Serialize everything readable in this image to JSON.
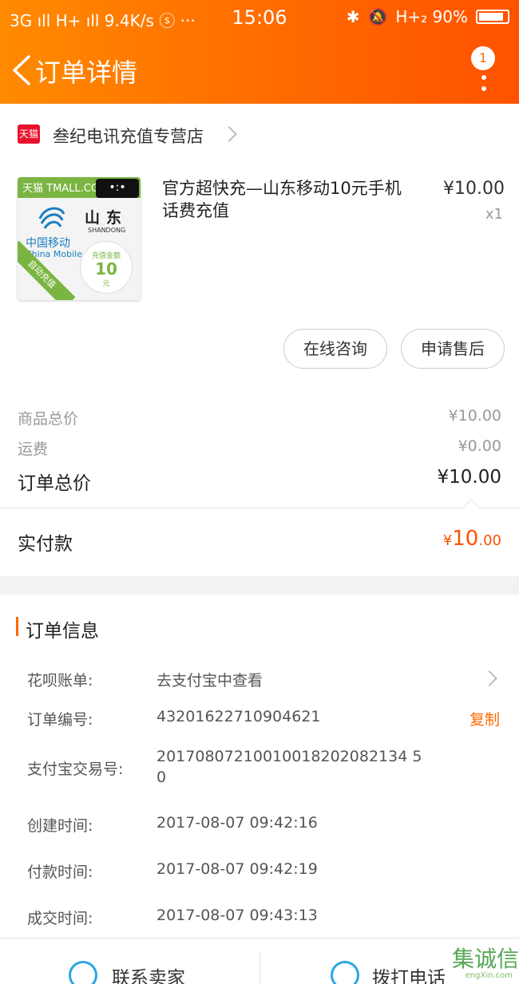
{
  "status_bar": {
    "left": "3G ıll H+ ıll 9.4K/s ⓢ ···",
    "time": "15:06",
    "right": "H+₂ 90%"
  },
  "header": {
    "title": "订单详情",
    "badge_count": "1"
  },
  "shop": {
    "logo_text": "天猫",
    "name": "叁纪电讯充值专营店"
  },
  "product": {
    "image": {
      "brand": "天猫 TMALL.COM",
      "cat_face": "•:•",
      "province": "山东",
      "province_en": "SHANDONG",
      "carrier_cn": "中国移动",
      "carrier_en": "China Mobile",
      "amount_label": "充值金额",
      "amount": "10",
      "unit": "元",
      "ribbon": "自动充值"
    },
    "title": "官方超快充—山东移动10元手机话费充值",
    "price": "¥10.00",
    "quantity": "x1"
  },
  "actions": {
    "consult": "在线咨询",
    "after_sale": "申请售后"
  },
  "fees": {
    "goods_label": "商品总价",
    "goods_value": "¥10.00",
    "shipping_label": "运费",
    "shipping_value": "¥0.00",
    "total_label": "订单总价",
    "total_value": "¥10.00",
    "paid_label": "实付款",
    "paid_currency": "¥",
    "paid_int": "10",
    "paid_dec": ".00"
  },
  "order_info": {
    "title": "订单信息",
    "huabei_label": "花呗账单:",
    "huabei_value": "去支付宝中查看",
    "order_no_label": "订单编号:",
    "order_no_value": "43201622710904621",
    "copy": "复制",
    "alipay_label": "支付宝交易号:",
    "alipay_line1": "20170807210010018202082134 5",
    "alipay_line2": "0",
    "created_label": "创建时间:",
    "created_value": "2017-08-07 09:42:16",
    "paid_label": "付款时间:",
    "paid_value": "2017-08-07 09:42:19",
    "deal_label": "成交时间:",
    "deal_value": "2017-08-07 09:43:13"
  },
  "bottom_bar": {
    "contact_seller": "联系卖家",
    "call_phone": "拨打电话"
  },
  "watermark": {
    "text": "集诚信",
    "sub": "engXin.com"
  },
  "colors": {
    "accent": "#ff6a00",
    "price_red": "#ff5000",
    "tmall_red": "#e8112d"
  }
}
